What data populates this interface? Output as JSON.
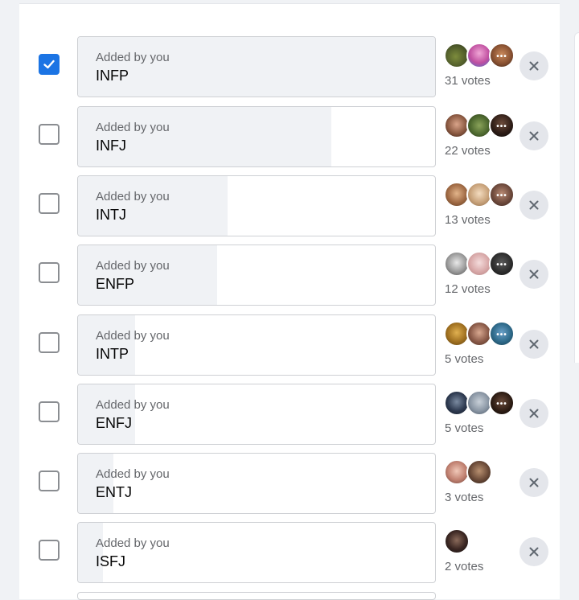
{
  "poll": {
    "options": [
      {
        "added_by": "Added by you",
        "label": "INFP",
        "votes_text": "31 votes",
        "checked": true,
        "share": 1.0,
        "avatars": [
          {
            "bg": "radial-gradient(circle at 45% 55%, #7d8c3c 0%, #4e5a2a 60%, #2d3518 100%)",
            "dots": false
          },
          {
            "bg": "radial-gradient(circle at 50% 40%, #f0a6d6 0%, #c04fa0 55%, #4a70c8 100%)",
            "dots": false
          },
          {
            "bg": "radial-gradient(circle at 50% 45%, #c9895b 0%, #8a5232 55%, #3c2418 100%)",
            "dots": true
          }
        ]
      },
      {
        "added_by": "Added by you",
        "label": "INFJ",
        "votes_text": "22 votes",
        "checked": false,
        "share": 0.71,
        "avatars": [
          {
            "bg": "radial-gradient(circle at 50% 45%, #d9a48a 0%, #8c5a42 55%, #3a2018 100%)",
            "dots": false
          },
          {
            "bg": "radial-gradient(circle at 50% 50%, #8aa35a 0%, #4f6a30 55%, #2a3818 100%)",
            "dots": false
          },
          {
            "bg": "radial-gradient(circle at 50% 40%, #6b4a3a 0%, #2a1a14 60%, #111 100%)",
            "dots": true
          }
        ]
      },
      {
        "added_by": "Added by you",
        "label": "INTJ",
        "votes_text": "13 votes",
        "checked": false,
        "share": 0.42,
        "avatars": [
          {
            "bg": "radial-gradient(circle at 50% 45%, #e2b48a 0%, #a06a44 55%, #5a3a22 100%)",
            "dots": false
          },
          {
            "bg": "radial-gradient(circle at 50% 45%, #f3dcc0 0%, #c8a27a 55%, #8a6a4a 100%)",
            "dots": false
          },
          {
            "bg": "radial-gradient(circle at 50% 45%, #b88a74 0%, #6e4a3c 55%, #3a2620 100%)",
            "dots": true
          }
        ]
      },
      {
        "added_by": "Added by you",
        "label": "ENFP",
        "votes_text": "12 votes",
        "checked": false,
        "share": 0.39,
        "avatars": [
          {
            "bg": "radial-gradient(circle at 50% 45%, #e8e8e8 0%, #9a9a9a 55%, #4a4a4a 100%)",
            "dots": false
          },
          {
            "bg": "radial-gradient(circle at 50% 45%, #f4dcdc 0%, #d8a8a8 55%, #b08080 100%)",
            "dots": false
          },
          {
            "bg": "radial-gradient(circle at 50% 45%, #5a5a5a 0%, #2e2e2e 55%, #111 100%)",
            "dots": true
          }
        ]
      },
      {
        "added_by": "Added by you",
        "label": "INTP",
        "votes_text": "5 votes",
        "checked": false,
        "share": 0.16,
        "avatars": [
          {
            "bg": "radial-gradient(circle at 50% 45%, #e0b050 0%, #a07020 55%, #5a4010 100%)",
            "dots": false
          },
          {
            "bg": "radial-gradient(circle at 50% 45%, #d8a890 0%, #8a5a48 55%, #4a2e22 100%)",
            "dots": false
          },
          {
            "bg": "radial-gradient(circle at 50% 45%, #6aa0c8 0%, #2e6a8a 55%, #163a4a 100%)",
            "dots": true
          }
        ]
      },
      {
        "added_by": "Added by you",
        "label": "ENFJ",
        "votes_text": "5 votes",
        "checked": false,
        "share": 0.16,
        "avatars": [
          {
            "bg": "radial-gradient(circle at 50% 45%, #7a8aa0 0%, #2e3a50 55%, #121a26 100%)",
            "dots": false
          },
          {
            "bg": "radial-gradient(circle at 50% 45%, #c8d0d8 0%, #8a96a4 55%, #4a5664 100%)",
            "dots": false
          },
          {
            "bg": "radial-gradient(circle at 50% 45%, #6a4a3a 0%, #2a1a12 60%, #0e0a08 100%)",
            "dots": true
          }
        ]
      },
      {
        "added_by": "Added by you",
        "label": "ENTJ",
        "votes_text": "3 votes",
        "checked": false,
        "share": 0.1,
        "avatars": [
          {
            "bg": "radial-gradient(circle at 50% 45%, #f0c8b8 0%, #c08070 55%, #6a4038 100%)",
            "dots": false
          },
          {
            "bg": "radial-gradient(circle at 50% 45%, #b89070 0%, #6a4a38 55%, #2a1c14 100%)",
            "dots": false
          }
        ]
      },
      {
        "added_by": "Added by you",
        "label": "ISFJ",
        "votes_text": "2 votes",
        "checked": false,
        "share": 0.07,
        "avatars": [
          {
            "bg": "radial-gradient(circle at 50% 45%, #8a6a5a 0%, #3a2622 55%, #121010 100%)",
            "dots": false
          }
        ]
      }
    ]
  },
  "colors": {
    "accent": "#1b74e4",
    "bar_fill": "#f0f2f5",
    "border": "#ced0d4",
    "secondary_text": "#65676b"
  },
  "icons": {
    "check": "check-icon",
    "remove": "close-icon",
    "more": "more-dots-icon"
  }
}
